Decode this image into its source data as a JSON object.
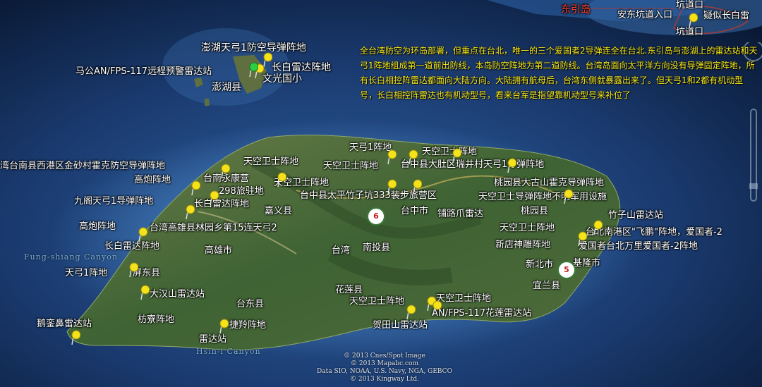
{
  "colors": {
    "ocean_deep": "#0b1d3a",
    "ocean_shelf": "#2f5f9e",
    "land": "#4a6b3a",
    "annotation": "#f7e81a",
    "pin": "#f4e21a",
    "highlight_red": "#ff3a2a"
  },
  "annotation_text": "全台湾防空为环岛部署，但重点在台北，唯一的三个爱国者2导弹连全在台北.东引岛与澎湖上的雷达站和天弓1阵地组成第一道前出防线，本岛防空阵地为第二道防线。台湾岛面向太平洋方向没有导弹固定阵地，所有长白相控阵雷达都面向大陆方向。大陆拥有航母后，台湾东侧就暴露出来了。但天弓1和2都有机动型号，长白相控阵雷达也有机动型号，看来台军是指望靠机动型号来补位了",
  "labels": {
    "dongyin": "东引岛",
    "andong": "安东坑道入口",
    "kengdao1": "坑道口",
    "kengdao2": "坑道口",
    "changbai_top": "疑似长白雷",
    "penghu_tg": "澎湖天弓1防空导弹阵地",
    "magong": "马公AN/FPS-117远程预警雷达站",
    "changbai_ph": "长白雷达阵地",
    "penghu": "澎湖县",
    "wenguang": "文光国小",
    "xigang": "湾台南县西港区金砂村霍克防空导弹阵地",
    "tg1_a": "天弓1阵地",
    "tg1_b": "天弓1阵地",
    "tk1": "天空卫士阵地",
    "tk2": "天空卫士阵地",
    "tk3": "天空卫士阵地",
    "taichung_tg": "台中县大肚区瑞井村天弓1导弹阵地",
    "taoyuan_hawk": "桃园县大古山霍克导弹阵地",
    "gaopao1": "高炮阵地",
    "gaopao2": "高炮阵地",
    "tainan_s": "台南永康营",
    "lv298": "298旅驻地",
    "taichung_gn": "台中县太平竹子坑333装步旅营区",
    "tk_site": "天空卫士导弹阵地不明军用设施",
    "jiuge": "九阁天弓1导弹阵地",
    "changbai2": "长白雷达阵地",
    "jiayi": "嘉义县",
    "taichung_c": "台中市",
    "pulu": "铺路爪雷达",
    "taoyuan": "桃园县",
    "zhuzishan": "竹子山雷达站",
    "kaohsiung_ly": "台湾高雄县林园乡第15连天弓2",
    "tk4": "天空卫士阵地",
    "taipei_nangang": "台北南港区\"飞鹏\"阵地，爱国者-2",
    "changbai3": "长白雷达阵地",
    "kaohsiung": "高雄市",
    "taiwan": "台湾",
    "nantou": "南投县",
    "xindian": "新店神雕阵地",
    "wanli": "爱国者台北万里爱国者-2阵地",
    "newtaipei": "新北市",
    "keelung": "基隆市",
    "tg1_pd": "天弓1阵地",
    "pingdong": "屏东县",
    "yilan": "宜兰县",
    "dahan": "大汉山雷达站",
    "hualien": "花莲县",
    "tk5": "天空卫士阵地",
    "tk6": "天空卫士阵地",
    "hualien_radar": "AN/FPS-117花莲雷达站",
    "taidong": "台东县",
    "eluanbi": "鹅銮鼻雷达站",
    "tk7": "天空卫士阵地",
    "jiejian": "捷羚阵地",
    "leidazhan": "雷达站",
    "jialishan": "贺田山雷达站",
    "fangliao": "枋寮阵地",
    "sea_north": "Fung-shiang Canyon",
    "sea_south": "Hsin-i Canyon"
  },
  "highway_shields": [
    "6",
    "5"
  ],
  "credits": [
    "© 2013 Cnes/Spot Image",
    "© 2013 Mapabc.com",
    "Data SIO, NOAA, U.S. Navy, NGA, GEBCO",
    "© 2013 Kingway Ltd."
  ]
}
